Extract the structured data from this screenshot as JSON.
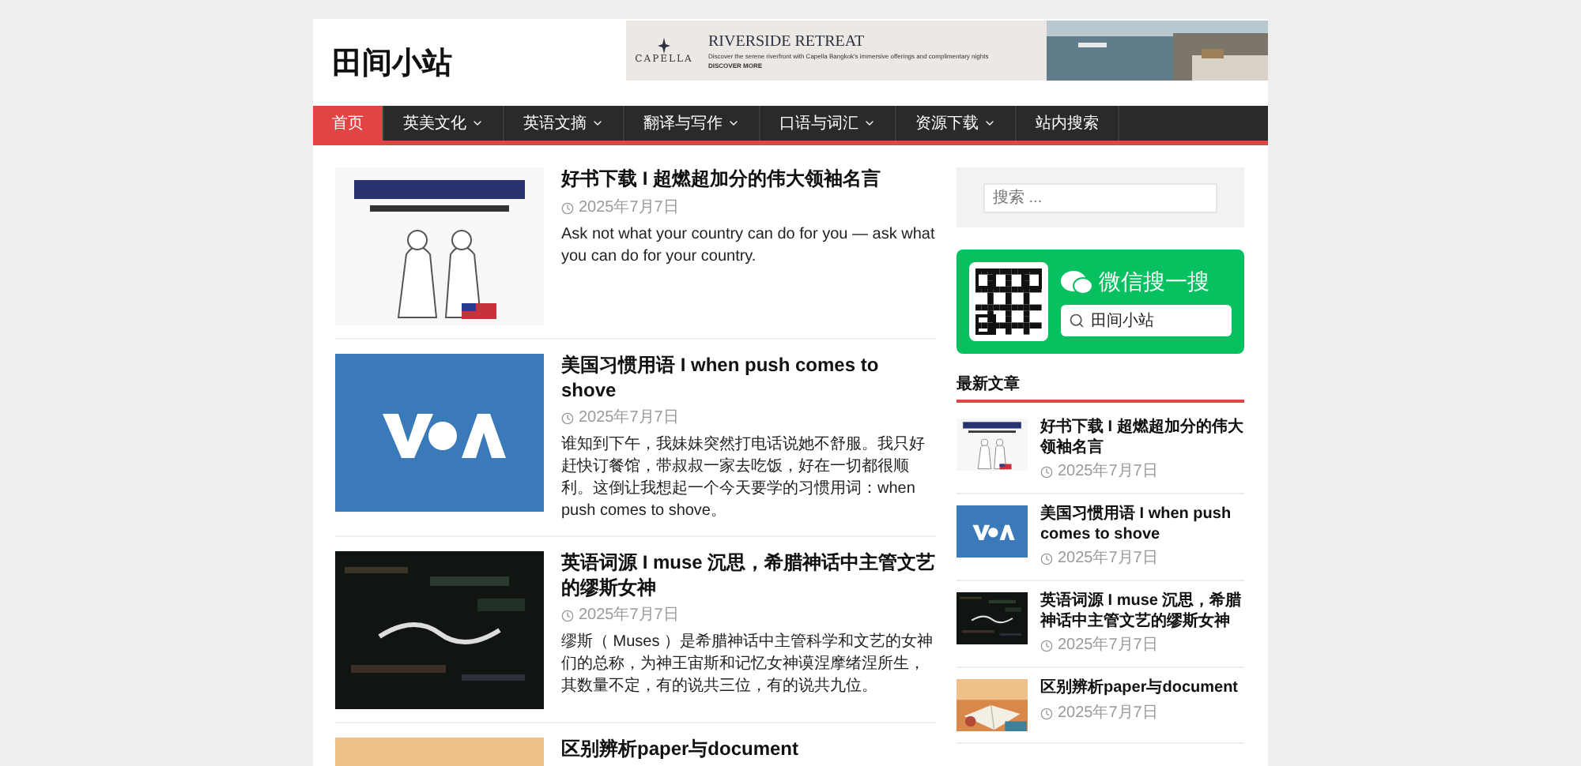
{
  "site": {
    "title": "田间小站"
  },
  "ad": {
    "brand": "CAPELLA",
    "headline": "RIVERSIDE RETREAT",
    "text": "Discover the serene riverfront with Capella Bangkok's immersive offerings and complimentary nights",
    "cta": "DISCOVER MORE"
  },
  "nav": [
    {
      "label": "首页",
      "selected": true,
      "has_menu": false
    },
    {
      "label": "英美文化",
      "selected": false,
      "has_menu": true
    },
    {
      "label": "英语文摘",
      "selected": false,
      "has_menu": true
    },
    {
      "label": "翻译与写作",
      "selected": false,
      "has_menu": true
    },
    {
      "label": "口语与词汇",
      "selected": false,
      "has_menu": true
    },
    {
      "label": "资源下载",
      "selected": false,
      "has_menu": true
    },
    {
      "label": "站内搜索",
      "selected": false,
      "has_menu": false
    }
  ],
  "articles": [
    {
      "title": "好书下载 I 超燃超加分的伟大领袖名言",
      "date": "2025年7月7日",
      "excerpt": "Ask not what your country can do for you — ask what you can do for your country."
    },
    {
      "title": "美国习惯用语 I when push comes to shove",
      "date": "2025年7月7日",
      "excerpt": "谁知到下午，我妹妹突然打电话说她不舒服。我只好赶快订餐馆，带叔叔一家去吃饭，好在一切都很顺利。这倒让我想起一个今天要学的习惯用词：when push comes to shove。"
    },
    {
      "title": "英语词源 I muse 沉思，希腊神话中主管文艺的缪斯女神",
      "date": "2025年7月7日",
      "excerpt": "缪斯（ Muses ）是希腊神话中主管科学和文艺的女神们的总称，为神王宙斯和记忆女神谟涅摩绪涅所生，其数量不定，有的说共三位，有的说共九位。"
    },
    {
      "title": "区别辨析paper与document"
    }
  ],
  "sidebar": {
    "search": {
      "placeholder": "搜索 ..."
    },
    "wechat": {
      "label": "微信搜一搜",
      "query": "田间小站"
    },
    "recent": {
      "heading": "最新文章",
      "items": [
        {
          "title": "好书下载 I 超燃超加分的伟大领袖名言",
          "date": "2025年7月7日"
        },
        {
          "title": "美国习惯用语 I when push comes to shove",
          "date": "2025年7月7日"
        },
        {
          "title": "英语词源 I muse 沉思，希腊神话中主管文艺的缪斯女神",
          "date": "2025年7月7日"
        },
        {
          "title": "区别辨析paper与document",
          "date": "2025年7月7日"
        }
      ]
    }
  }
}
